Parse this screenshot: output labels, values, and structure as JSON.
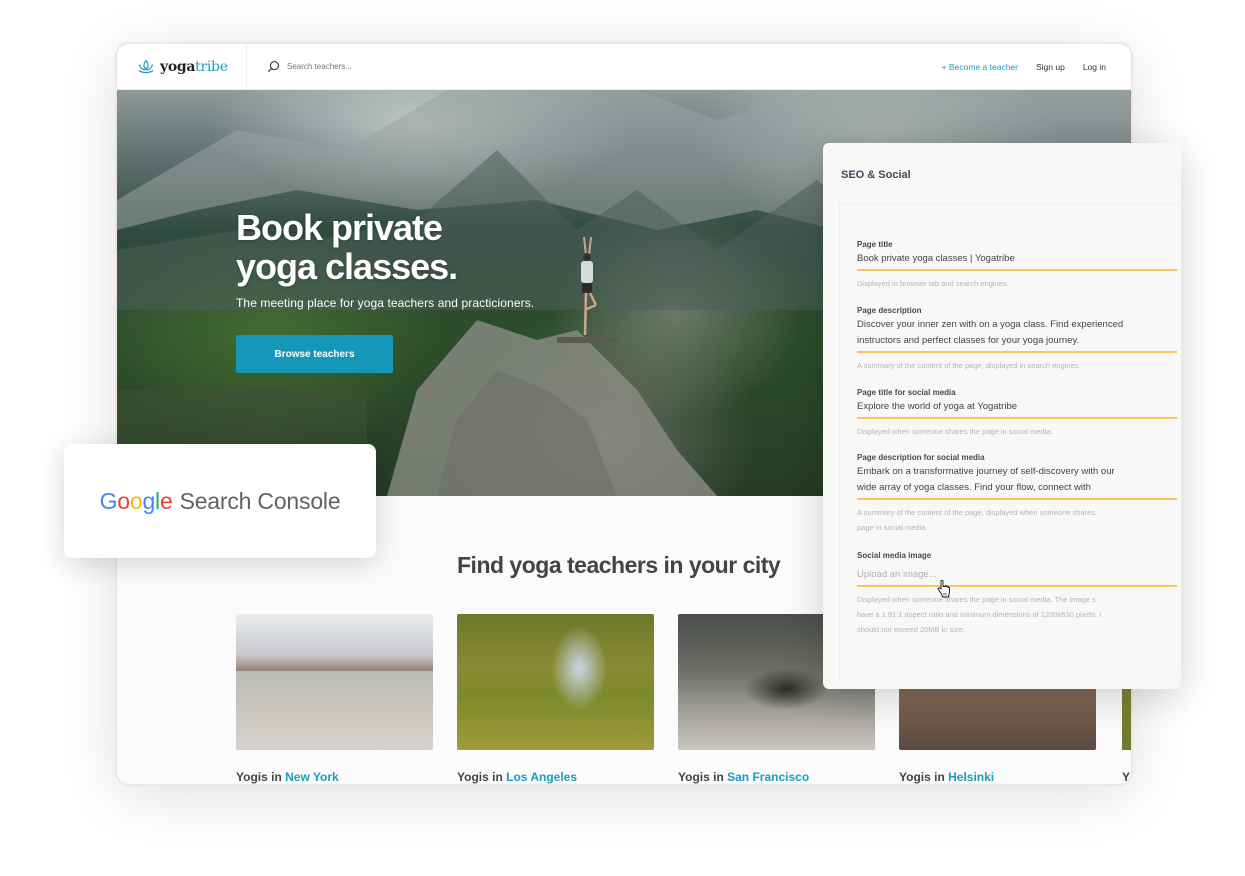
{
  "navbar": {
    "logo_primary": "yoga",
    "logo_accent": "tribe",
    "search_placeholder": "Search teachers...",
    "links": {
      "become_teacher": "+ Become a teacher",
      "sign_up": "Sign up",
      "log_in": "Log in"
    }
  },
  "hero": {
    "title_line1": "Book private",
    "title_line2": "yoga classes.",
    "subtitle": "The meeting place for yoga teachers and practicioners.",
    "cta_label": "Browse teachers"
  },
  "cities_section": {
    "title": "Find yoga teachers in your city",
    "prefix": "Yogis in",
    "cities": [
      {
        "name": "New York"
      },
      {
        "name": "Los Angeles"
      },
      {
        "name": "San Francisco"
      },
      {
        "name": "Helsinki"
      }
    ],
    "partial_label": "Y"
  },
  "seo_panel": {
    "title": "SEO & Social",
    "fields": [
      {
        "label": "Page title",
        "value": "Book private yoga classes | Yogatribe",
        "help": "Displayed in browser tab and search engines."
      },
      {
        "label": "Page description",
        "value_line1": "Discover your inner zen with on a yoga class. Find experienced",
        "value_line2": "instructors and perfect classes for your yoga journey.",
        "help": "A summary of the content of the page, displayed in search engines."
      },
      {
        "label": "Page title for social media",
        "value": "Explore the world of yoga at Yogatribe",
        "help": "Displayed when someone shares the page in social media."
      },
      {
        "label": "Page description for social media",
        "value_line1": "Embark on a transformative journey of self-discovery with our",
        "value_line2": "wide array of yoga classes. Find your flow, connect with",
        "help_line1": "A summary of the content of the page, displayed when someone shares",
        "help_line2": "page in social media."
      },
      {
        "label": "Social media image",
        "placeholder": "Upload an image...",
        "help_line1": "Displayed when someone shares the page in social media. The image s",
        "help_line2": "have a 1.91:1 aspect ratio and minimum dimensions of 1200x630 pixels. I",
        "help_line3": "should not exceed 20MB in size."
      }
    ]
  },
  "gsc_card": {
    "google": [
      "G",
      "o",
      "o",
      "g",
      "l",
      "e"
    ],
    "product": "Search Console"
  },
  "colors": {
    "accent": "#1a9dbf",
    "cta": "#1497b8",
    "field_underline": "#f7c857"
  }
}
